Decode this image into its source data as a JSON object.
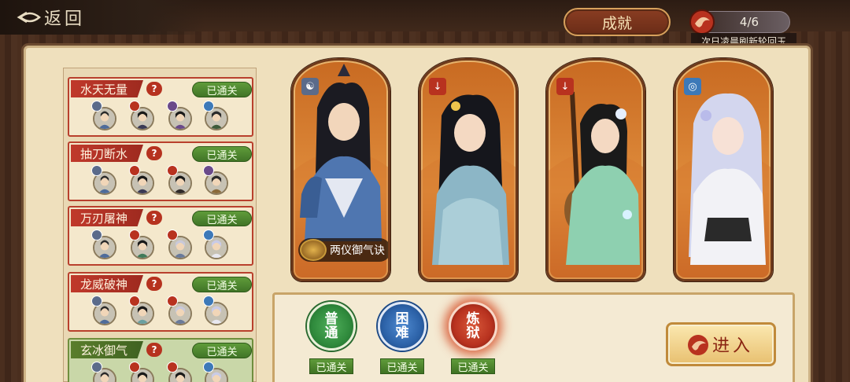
{
  "header": {
    "back_label": "返回",
    "achievement_label": "成就",
    "jade_count": "4/6",
    "refresh_note": "次日凌晨刷新轮回玉"
  },
  "stages": [
    {
      "name": "水天无量",
      "status": "已通关",
      "selected": false
    },
    {
      "name": "抽刀断水",
      "status": "已通关",
      "selected": false
    },
    {
      "name": "万刃屠神",
      "status": "已通关",
      "selected": false
    },
    {
      "name": "龙威破神",
      "status": "已通关",
      "selected": false
    },
    {
      "name": "玄冰御气",
      "status": "已通关",
      "selected": true
    }
  ],
  "help_glyph": "?",
  "cards": [
    {
      "element": "yin-yang-icon",
      "glyph": "☯",
      "elem_color": "#5b6b8a",
      "skill": "两仪御气诀"
    },
    {
      "element": "sword-icon",
      "glyph": "↓",
      "elem_color": "#b8321f",
      "skill": ""
    },
    {
      "element": "sword-icon",
      "glyph": "↓",
      "elem_color": "#b8321f",
      "skill": ""
    },
    {
      "element": "swirl-icon",
      "glyph": "◎",
      "elem_color": "#3d79b8",
      "skill": ""
    }
  ],
  "difficulties": [
    {
      "line1": "普",
      "line2": "通",
      "status": "已通关",
      "color": "#2f8a3c"
    },
    {
      "line1": "困",
      "line2": "难",
      "status": "已通关",
      "color": "#2c62a8"
    },
    {
      "line1": "炼",
      "line2": "狱",
      "status": "已通关",
      "color": "#b8321f"
    }
  ],
  "enter_label": "进入",
  "colors": {
    "accent_red": "#b8321f",
    "cleared_green": "#4f8a2f",
    "parchment": "#efe0bd"
  }
}
